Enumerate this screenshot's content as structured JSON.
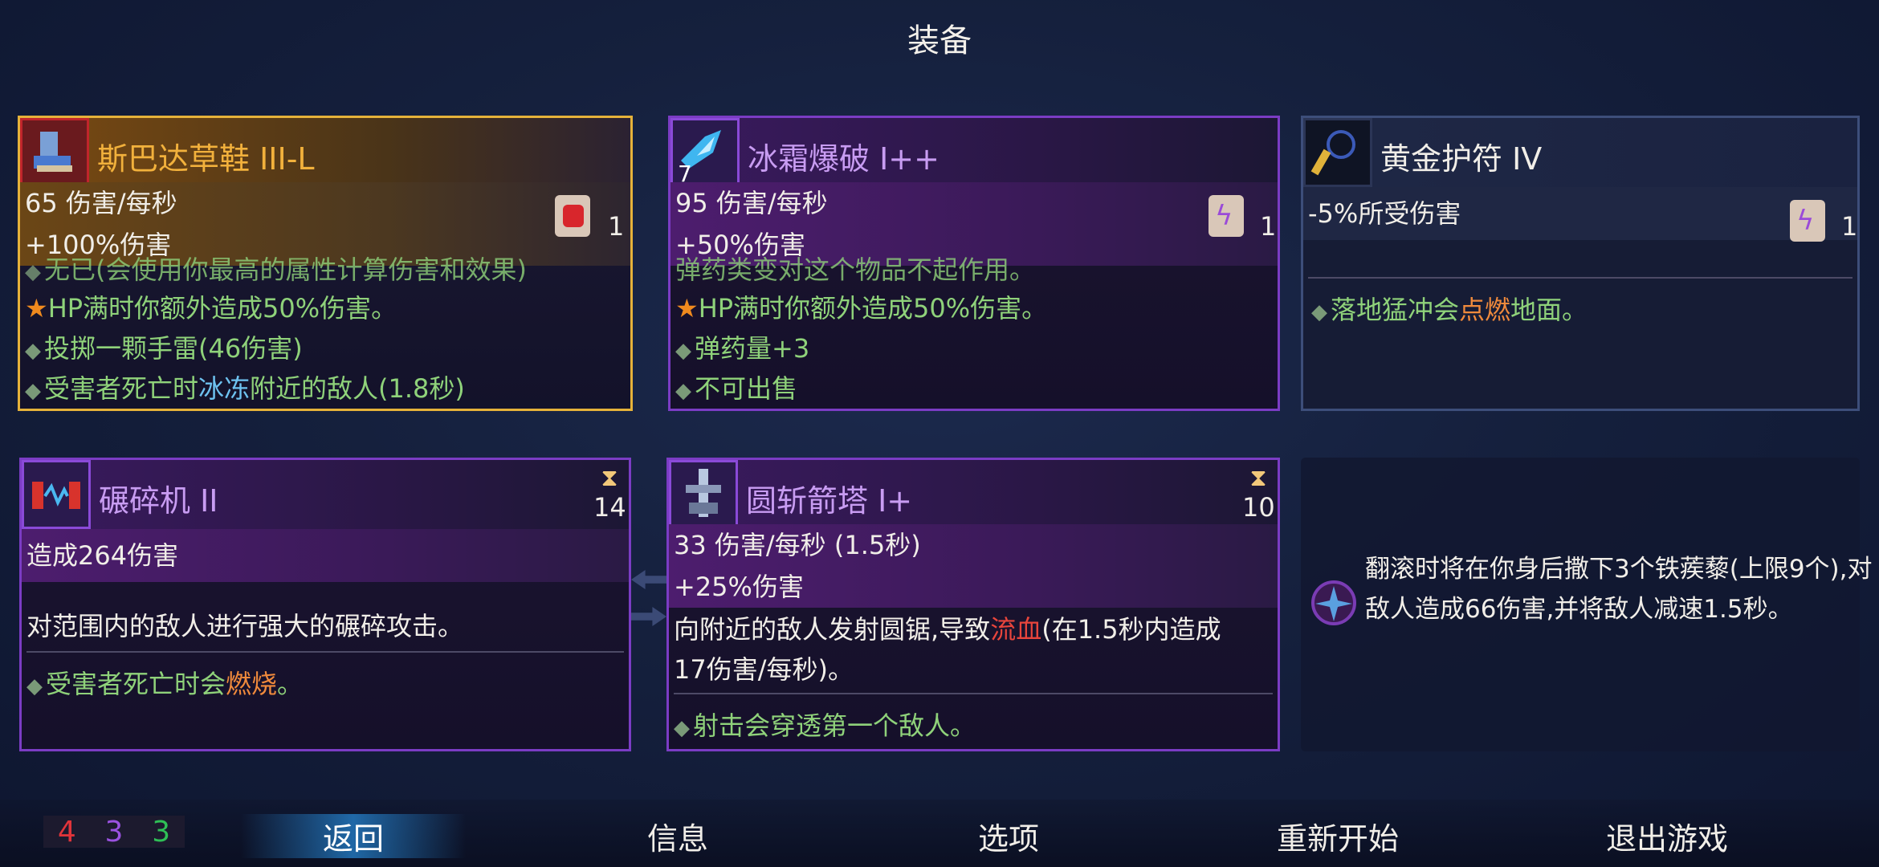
{
  "title": "装备",
  "cards": {
    "sparta": {
      "name": "斯巴达草鞋 III-L",
      "stats": [
        "65 伤害/每秒",
        "+100%伤害"
      ],
      "scroll_count": "1",
      "lines": [
        "无已(会使用你最高的属性计算伤害和效果)",
        "HP满时你额外造成50%伤害。",
        "投掷一颗手雷(46伤害)",
        "受害者死亡时",
        "冰冻",
        "附近的敌人(1.8秒)"
      ]
    },
    "frost": {
      "name": "冰霜爆破 I++",
      "level": "7",
      "stats": [
        "95 伤害/每秒",
        "+50%伤害"
      ],
      "scroll_count": "1",
      "lines": [
        "弹药类变对这个物品不起作用。",
        "HP满时你额外造成50%伤害。",
        "弹药量+3",
        "不可出售"
      ]
    },
    "amulet": {
      "name": "黄金护符 IV",
      "stats": [
        "-5%所受伤害"
      ],
      "scroll_count": "1",
      "lines": [
        "落地猛冲会",
        "点燃",
        "地面。"
      ]
    },
    "crusher": {
      "name": "碾碎机 II",
      "timer": "14",
      "stats": [
        "造成264伤害"
      ],
      "lines": [
        "对范围内的敌人进行强大的碾碎攻击。",
        "受害者死亡时会",
        "燃烧",
        "。"
      ]
    },
    "tower": {
      "name": "圆斩箭塔 I+",
      "timer": "10",
      "stats": [
        "33 伤害/每秒 (1.5秒)",
        "+25%伤害"
      ],
      "lines": [
        "向附近的敌人发射圆锯,导致",
        "流血",
        "(在1.5秒内造成",
        "17伤害/每秒)。",
        "射击会穿透第一个敌人。"
      ]
    },
    "caltrop": {
      "text": "翻滚时将在你身后撒下3个铁蒺藜(上限9个),对敌人造成66伤害,并将敌人减速1.5秒。"
    }
  },
  "counters": [
    "4",
    "3",
    "3"
  ],
  "nav": [
    "返回",
    "信息",
    "选项",
    "重新开始",
    "退出游戏"
  ],
  "colors": {
    "gold_border": "#e5b23a",
    "purple_border": "#7b3cc4",
    "green_text": "#8fd27a",
    "active_nav": "#2a8cdc"
  }
}
